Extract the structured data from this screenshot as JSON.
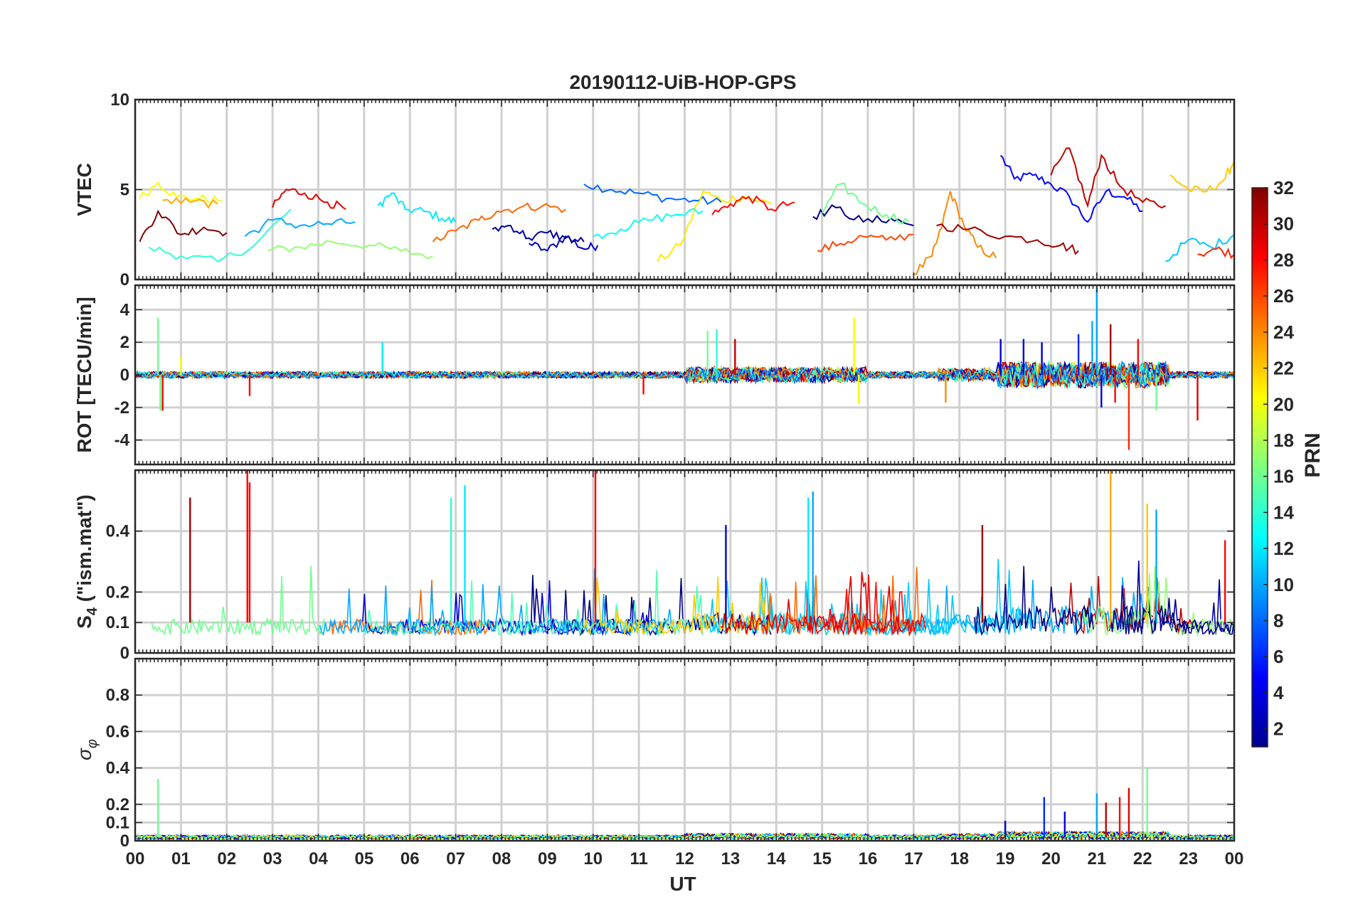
{
  "chart_data": {
    "type": "line",
    "title": "20190112-UiB-HOP-GPS",
    "xlabel": "UT",
    "x_ticks": [
      "00",
      "01",
      "02",
      "03",
      "04",
      "05",
      "06",
      "07",
      "08",
      "09",
      "10",
      "11",
      "12",
      "13",
      "14",
      "15",
      "16",
      "17",
      "18",
      "19",
      "20",
      "21",
      "22",
      "23",
      "00"
    ],
    "x_range_hours": [
      0,
      24
    ],
    "grid": true,
    "colorbar": {
      "label": "PRN",
      "range": [
        1,
        32
      ],
      "ticks": [
        "2",
        "4",
        "6",
        "8",
        "10",
        "12",
        "14",
        "16",
        "18",
        "20",
        "22",
        "24",
        "26",
        "28",
        "30",
        "32"
      ],
      "colormap": "jet",
      "colormap_colors": [
        "#00008f",
        "#0000ff",
        "#0080ff",
        "#00ffff",
        "#80ff80",
        "#ffff00",
        "#ff8000",
        "#ff0000",
        "#800000"
      ]
    },
    "panels": [
      {
        "id": "vtec",
        "ylabel": "VTEC",
        "ylim": [
          0,
          10
        ],
        "y_ticks": [
          "0",
          "5",
          "10"
        ],
        "tracks": [
          {
            "prn": 5,
            "x": [
              18.9,
              19.2,
              19.6,
              20.0,
              20.4,
              20.8,
              21.2,
              21.6,
              22.0
            ],
            "y": [
              6.9,
              5.6,
              5.8,
              5.3,
              4.6,
              3.2,
              4.9,
              4.6,
              3.8
            ]
          },
          {
            "prn": 3,
            "x": [
              8.6,
              9.0,
              9.4,
              9.8,
              10.1
            ],
            "y": [
              2.0,
              1.6,
              2.4,
              1.7,
              1.9
            ]
          },
          {
            "prn": 8,
            "x": [
              9.8,
              10.4,
              11.0,
              11.6,
              12.2,
              12.8
            ],
            "y": [
              5.3,
              5.0,
              4.8,
              4.5,
              4.4,
              4.3
            ]
          },
          {
            "prn": 12,
            "x": [
              5.3,
              5.6,
              5.9,
              6.3,
              6.7,
              7.0
            ],
            "y": [
              4.1,
              4.8,
              3.9,
              3.8,
              3.4,
              3.2
            ]
          },
          {
            "prn": 14,
            "x": [
              0.3,
              1.0,
              1.8,
              2.6,
              3.4
            ],
            "y": [
              1.8,
              1.3,
              1.0,
              1.9,
              3.9
            ]
          },
          {
            "prn": 17,
            "x": [
              2.9,
              3.6,
              4.3,
              5.1,
              5.8,
              6.5
            ],
            "y": [
              1.6,
              1.8,
              2.1,
              1.9,
              1.6,
              1.3
            ]
          },
          {
            "prn": 20,
            "x": [
              0.1,
              0.5,
              0.9,
              1.4,
              1.9
            ],
            "y": [
              4.5,
              5.4,
              4.6,
              4.5,
              4.4
            ]
          },
          {
            "prn": 21,
            "x": [
              11.4,
              11.9,
              12.4,
              12.8,
              13.3,
              13.9
            ],
            "y": [
              1.0,
              1.9,
              4.9,
              4.4,
              4.6,
              4.2
            ]
          },
          {
            "prn": 22,
            "x": [
              22.6,
              23.0,
              23.4,
              23.8,
              24.0
            ],
            "y": [
              5.8,
              5.0,
              4.9,
              5.6,
              6.6
            ]
          },
          {
            "prn": 24,
            "x": [
              17.0,
              17.4,
              17.6,
              17.8,
              18.1,
              18.4,
              18.8
            ],
            "y": [
              0.3,
              1.3,
              2.8,
              4.9,
              3.0,
              1.8,
              1.2
            ]
          },
          {
            "prn": 25,
            "x": [
              6.5,
              7.0,
              7.5,
              7.9,
              8.4,
              8.9,
              9.4
            ],
            "y": [
              2.1,
              2.7,
              3.3,
              3.8,
              4.0,
              4.1,
              3.9
            ]
          },
          {
            "prn": 28,
            "x": [
              12.6,
              13.0,
              13.4,
              13.9,
              14.4
            ],
            "y": [
              3.6,
              4.2,
              4.6,
              3.9,
              4.3
            ]
          },
          {
            "prn": 29,
            "x": [
              3.0,
              3.3,
              3.7,
              4.2,
              4.6
            ],
            "y": [
              4.0,
              5.0,
              4.8,
              4.3,
              3.9
            ]
          },
          {
            "prn": 30,
            "x": [
              20.0,
              20.4,
              20.8,
              21.1,
              21.5,
              22.0,
              22.5
            ],
            "y": [
              5.8,
              7.3,
              4.1,
              6.9,
              5.2,
              4.3,
              4.1
            ]
          },
          {
            "prn": 31,
            "x": [
              17.5,
              18.2,
              19.0,
              19.7,
              20.2,
              20.6
            ],
            "y": [
              3.0,
              2.8,
              2.4,
              2.2,
              1.9,
              1.6
            ]
          },
          {
            "prn": 32,
            "x": [
              0.1,
              0.5,
              1.0,
              1.5,
              2.0
            ],
            "y": [
              2.1,
              3.8,
              2.5,
              2.9,
              2.6
            ]
          },
          {
            "prn": 1,
            "x": [
              14.8,
              15.3,
              15.9,
              16.5,
              17.0
            ],
            "y": [
              3.5,
              4.0,
              3.2,
              3.4,
              3.0
            ]
          },
          {
            "prn": 10,
            "x": [
              2.4,
              3.0,
              3.6,
              4.2,
              4.8
            ],
            "y": [
              2.4,
              3.3,
              3.0,
              3.1,
              3.2
            ]
          },
          {
            "prn": 16,
            "x": [
              15.0,
              15.4,
              15.9,
              16.4,
              16.9
            ],
            "y": [
              3.7,
              5.3,
              4.2,
              3.6,
              3.2
            ]
          },
          {
            "prn": 26,
            "x": [
              14.9,
              15.4,
              15.9,
              16.4,
              17.0
            ],
            "y": [
              1.6,
              2.0,
              2.4,
              2.2,
              2.5
            ]
          },
          {
            "prn": 11,
            "x": [
              22.5,
              23.0,
              23.5,
              24.0
            ],
            "y": [
              1.0,
              2.2,
              1.8,
              2.5
            ]
          },
          {
            "prn": 27,
            "x": [
              23.2,
              23.6,
              24.0
            ],
            "y": [
              1.4,
              1.7,
              1.4
            ]
          },
          {
            "prn": 13,
            "x": [
              10.0,
              10.6,
              11.2,
              11.8,
              12.4
            ],
            "y": [
              2.4,
              2.8,
              3.3,
              3.6,
              3.8
            ]
          },
          {
            "prn": 2,
            "x": [
              7.8,
              8.2,
              8.6,
              9.0,
              9.4,
              9.8
            ],
            "y": [
              2.8,
              3.0,
              2.3,
              2.6,
              2.3,
              2.1
            ]
          },
          {
            "prn": 23,
            "x": [
              0.6,
              1.2,
              1.8
            ],
            "y": [
              4.4,
              4.3,
              4.2
            ]
          }
        ]
      },
      {
        "id": "rot",
        "ylabel": "ROT [TECU/min]",
        "ylim": [
          -5.5,
          5.5
        ],
        "y_ticks": [
          "-4",
          "-2",
          "0",
          "2",
          "4"
        ],
        "spikes": [
          {
            "x": 0.5,
            "y": 3.5,
            "prn": 16
          },
          {
            "x": 0.55,
            "y": -2.2,
            "prn": 16
          },
          {
            "x": 0.6,
            "y": -2.2,
            "prn": 28
          },
          {
            "x": 1.0,
            "y": 1.1,
            "prn": 20
          },
          {
            "x": 2.5,
            "y": -1.3,
            "prn": 28
          },
          {
            "x": 5.4,
            "y": 2.0,
            "prn": 12
          },
          {
            "x": 11.1,
            "y": -1.2,
            "prn": 28
          },
          {
            "x": 12.5,
            "y": 2.7,
            "prn": 16
          },
          {
            "x": 12.7,
            "y": 2.8,
            "prn": 14
          },
          {
            "x": 13.1,
            "y": 2.2,
            "prn": 30
          },
          {
            "x": 15.7,
            "y": 3.5,
            "prn": 20
          },
          {
            "x": 15.8,
            "y": -1.8,
            "prn": 20
          },
          {
            "x": 17.7,
            "y": -1.7,
            "prn": 24
          },
          {
            "x": 18.9,
            "y": 2.2,
            "prn": 4
          },
          {
            "x": 19.4,
            "y": 2.2,
            "prn": 4
          },
          {
            "x": 19.8,
            "y": 2.0,
            "prn": 3
          },
          {
            "x": 20.6,
            "y": 2.5,
            "prn": 6
          },
          {
            "x": 20.9,
            "y": 3.3,
            "prn": 10
          },
          {
            "x": 21.0,
            "y": 5.4,
            "prn": 10
          },
          {
            "x": 21.1,
            "y": -2.0,
            "prn": 4
          },
          {
            "x": 21.3,
            "y": 3.1,
            "prn": 31
          },
          {
            "x": 21.4,
            "y": -1.7,
            "prn": 28
          },
          {
            "x": 21.7,
            "y": -4.6,
            "prn": 27
          },
          {
            "x": 21.9,
            "y": 2.2,
            "prn": 28
          },
          {
            "x": 22.3,
            "y": -2.2,
            "prn": 16
          },
          {
            "x": 23.2,
            "y": -2.8,
            "prn": 29
          }
        ]
      },
      {
        "id": "s4",
        "ylabel": "S",
        "ylabel_sub": "4",
        "ylabel_tail": " (\"ism.mat\")",
        "ylim": [
          0,
          0.6
        ],
        "y_ticks": [
          "0",
          "0.1",
          "0.2",
          "0.4"
        ],
        "spikes": [
          {
            "x": 1.2,
            "y": 0.51,
            "prn": 31
          },
          {
            "x": 2.45,
            "y": 0.6,
            "prn": 28
          },
          {
            "x": 2.5,
            "y": 0.56,
            "prn": 28
          },
          {
            "x": 6.9,
            "y": 0.51,
            "prn": 14
          },
          {
            "x": 7.2,
            "y": 0.55,
            "prn": 12
          },
          {
            "x": 10.05,
            "y": 0.6,
            "prn": 28
          },
          {
            "x": 12.9,
            "y": 0.42,
            "prn": 4
          },
          {
            "x": 14.7,
            "y": 0.51,
            "prn": 12
          },
          {
            "x": 14.8,
            "y": 0.53,
            "prn": 10
          },
          {
            "x": 18.5,
            "y": 0.42,
            "prn": 31
          },
          {
            "x": 21.3,
            "y": 0.6,
            "prn": 23
          },
          {
            "x": 22.1,
            "y": 0.49,
            "prn": 22
          },
          {
            "x": 22.3,
            "y": 0.47,
            "prn": 10
          },
          {
            "x": 23.8,
            "y": 0.37,
            "prn": 28
          }
        ]
      },
      {
        "id": "sigma",
        "ylabel": "σ",
        "ylabel_sub": "φ",
        "ylim": [
          0,
          1
        ],
        "y_ticks": [
          "0",
          "0.1",
          "0.2",
          "0.4",
          "0.6",
          "0.8"
        ],
        "spikes": [
          {
            "x": 0.5,
            "y": 0.34,
            "prn": 16
          },
          {
            "x": 19.0,
            "y": 0.11,
            "prn": 3
          },
          {
            "x": 19.85,
            "y": 0.24,
            "prn": 6
          },
          {
            "x": 20.3,
            "y": 0.16,
            "prn": 4
          },
          {
            "x": 21.0,
            "y": 0.26,
            "prn": 10
          },
          {
            "x": 21.2,
            "y": 0.21,
            "prn": 30
          },
          {
            "x": 21.5,
            "y": 0.24,
            "prn": 28
          },
          {
            "x": 21.7,
            "y": 0.29,
            "prn": 29
          },
          {
            "x": 22.1,
            "y": 0.4,
            "prn": 16
          }
        ]
      }
    ]
  }
}
